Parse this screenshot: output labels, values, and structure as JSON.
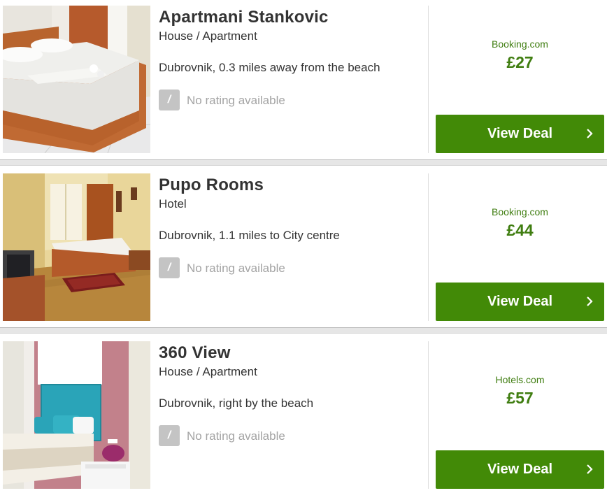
{
  "listings": [
    {
      "name": "Apartmani Stankovic",
      "type": "House / Apartment",
      "location": "Dubrovnik, 0.3 miles away from the beach",
      "rating_badge": "/",
      "rating_text": "No rating available",
      "provider": "Booking.com",
      "price": "£27",
      "deal_label": "View Deal",
      "photo_icon": "bedroom-photo"
    },
    {
      "name": "Pupo Rooms",
      "type": "Hotel",
      "location": "Dubrovnik, 1.1 miles to City centre",
      "rating_badge": "/",
      "rating_text": "No rating available",
      "provider": "Booking.com",
      "price": "£44",
      "deal_label": "View Deal",
      "photo_icon": "hotel-room-photo"
    },
    {
      "name": "360 View",
      "type": "House / Apartment",
      "location": "Dubrovnik, right by the beach",
      "rating_badge": "/",
      "rating_text": "No rating available",
      "provider": "Hotels.com",
      "price": "£57",
      "deal_label": "View Deal",
      "photo_icon": "modern-bedroom-photo"
    }
  ],
  "colors": {
    "deal_button": "#428a07",
    "price": "#3f7d10",
    "rating_badge": "#c4c4c4",
    "muted_text": "#a3a3a3"
  }
}
